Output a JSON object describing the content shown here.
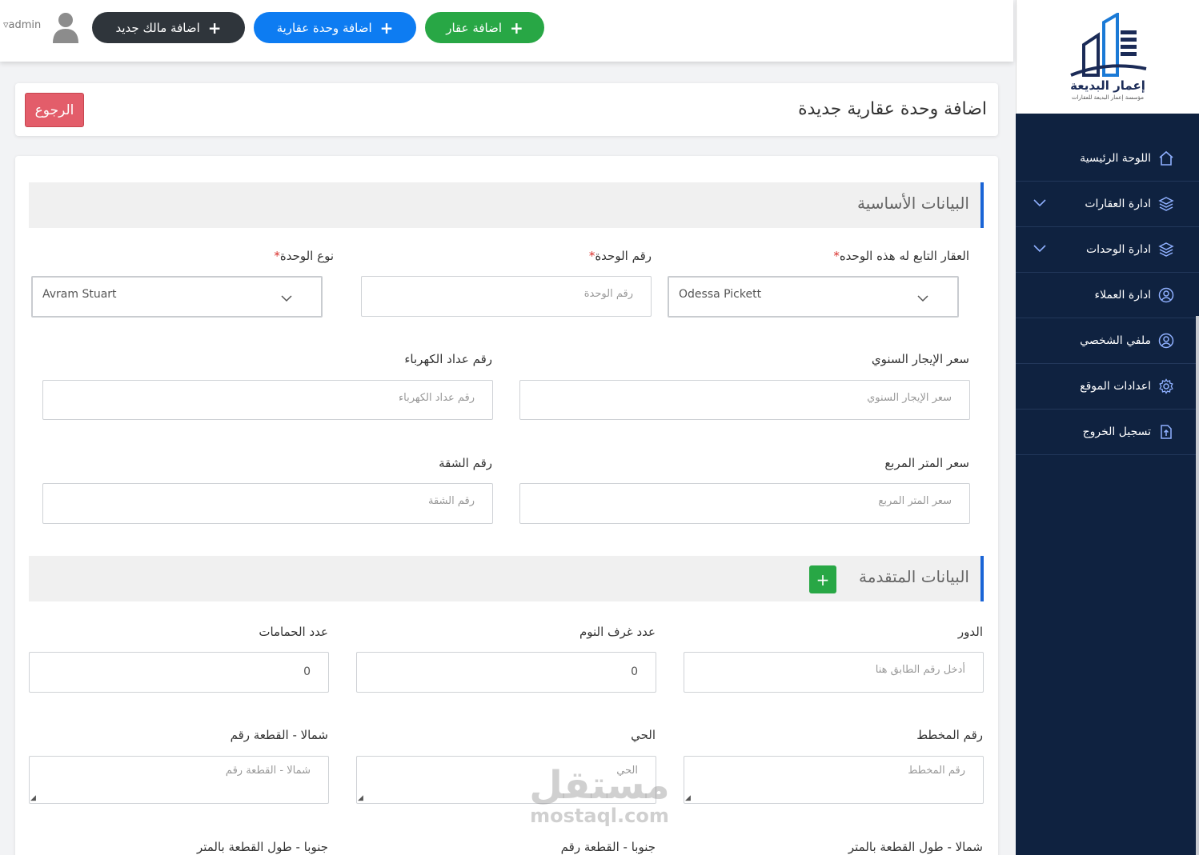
{
  "sidebar": {
    "logo": {
      "name": "إعمار البديعة",
      "subtitle": "مؤسسة إعمار البديعة للعقارات"
    },
    "items": [
      {
        "label": "اللوحة الرئيسية",
        "icon": "home-icon",
        "has_submenu": false
      },
      {
        "label": "ادارة العقارات",
        "icon": "layers-icon",
        "has_submenu": true
      },
      {
        "label": "ادارة الوحدات",
        "icon": "layers-icon",
        "has_submenu": true
      },
      {
        "label": "ادارة العملاء",
        "icon": "user-circle-icon",
        "has_submenu": false
      },
      {
        "label": "ملفي الشخصي",
        "icon": "user-circle-icon",
        "has_submenu": false
      },
      {
        "label": "اعدادات الموقع",
        "icon": "gear-icon",
        "has_submenu": false
      },
      {
        "label": "تسجيل الخروج",
        "icon": "logout-file-icon",
        "has_submenu": false
      }
    ]
  },
  "topbar": {
    "add_property": "اضافة عقار",
    "add_unit": "اضافة وحدة عقارية",
    "add_owner": "اضافة مالك جديد",
    "user": "admin"
  },
  "page": {
    "title": "اضافة وحدة عقارية جديدة",
    "back": "الرجوع"
  },
  "basic": {
    "section_title": "البيانات الأساسية",
    "property_label": "العقار التابع له هذه الوحده",
    "property_value": "Odessa Pickett",
    "unit_number_label": "رقم الوحدة",
    "unit_number_placeholder": "رقم الوحدة",
    "unit_type_label": "نوع الوحدة",
    "unit_type_value": "Avram Stuart",
    "annual_rent_label": "سعر الإيجار السنوي",
    "annual_rent_placeholder": "سعر الإيجار السنوي",
    "meter_label": "رقم عداد الكهرباء",
    "meter_placeholder": "رقم عداد الكهرباء",
    "sqm_price_label": "سعر المتر المربع",
    "sqm_price_placeholder": "سعر المتر المربع",
    "apartment_label": "رقم الشقة",
    "apartment_placeholder": "رقم الشقة",
    "required_mark": "*"
  },
  "advanced": {
    "section_title": "البيانات المتقدمة",
    "add_label": "+",
    "floor_label": "الدور",
    "floor_placeholder": "أدخل رقم الطابق هنا",
    "bedrooms_label": "عدد غرف النوم",
    "bedrooms_value": "0",
    "bathrooms_label": "عدد الحمامات",
    "bathrooms_value": "0",
    "plan_label": "رقم المخطط",
    "plan_placeholder": "رقم المخطط",
    "district_label": "الحي",
    "district_placeholder": "الحي",
    "north_plot_label": "شمالا - القطعة رقم",
    "north_plot_placeholder": "شمالا - القطعة رقم",
    "north_len_label": "شمالا - طول القطعة بالمتر",
    "south_plot_label": "جنوبا - القطعة رقم",
    "south_len_label": "جنوبا - طول القطعة بالمتر"
  },
  "watermark": {
    "arabic": "مستقل",
    "english": "mostaql.com"
  }
}
